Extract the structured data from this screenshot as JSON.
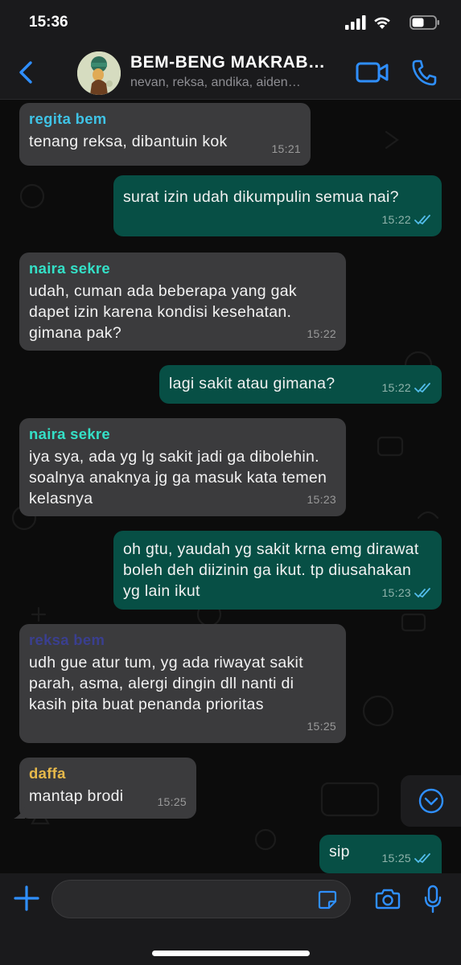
{
  "status_bar": {
    "time": "15:36",
    "icons": [
      "signal-icon",
      "wifi-icon",
      "battery-icon"
    ]
  },
  "header": {
    "title": "BEM-BENG MAKRAB…",
    "members": "nevan, reksa, andika, aiden…",
    "icons": [
      "back-icon",
      "video-call-icon",
      "phone-icon"
    ]
  },
  "colors": {
    "accent": "#2f8fff",
    "incoming_bubble": "#3b3b3d",
    "outgoing_bubble": "#074f45",
    "read_ticks": "#53bdeb"
  },
  "messages": [
    {
      "dir": "in",
      "sender": "regita bem",
      "sender_color": "#3fc3e6",
      "text": "tenang reksa, dibantuin kok",
      "time": "15:21"
    },
    {
      "dir": "out",
      "text": "surat izin udah dikumpulin semua nai?",
      "time": "15:22",
      "status": "read"
    },
    {
      "dir": "in",
      "sender": "naira sekre",
      "sender_color": "#34e0c7",
      "text": "udah, cuman ada beberapa yang gak dapet izin karena kondisi kesehatan. gimana pak?",
      "time": "15:22"
    },
    {
      "dir": "out",
      "text": "lagi sakit atau gimana?",
      "time": "15:22",
      "status": "read"
    },
    {
      "dir": "in",
      "sender": "naira sekre",
      "sender_color": "#34e0c7",
      "text": "iya sya, ada yg lg sakit jadi ga dibolehin. soalnya anaknya jg ga masuk kata temen kelasnya",
      "time": "15:23"
    },
    {
      "dir": "out",
      "text": "oh gtu, yaudah yg sakit krna emg dirawat boleh deh diizinin ga ikut. tp diusahakan yg lain ikut",
      "time": "15:23",
      "status": "read"
    },
    {
      "dir": "in",
      "sender": "reksa bem",
      "sender_color": "#3a3f8f",
      "text": "udh gue atur tum, yg ada riwayat sakit parah, asma, alergi dingin dll nanti di kasih pita buat penanda prioritas",
      "time": "15:25"
    },
    {
      "dir": "in",
      "sender": "daffa",
      "sender_color": "#e6b84a",
      "text": "mantap brodi",
      "time": "15:25"
    },
    {
      "dir": "out",
      "text": "sip",
      "time": "15:25",
      "status": "read"
    }
  ],
  "input": {
    "placeholder": "",
    "value": ""
  },
  "input_icons": [
    "plus-icon",
    "sticker-icon",
    "camera-icon",
    "mic-icon"
  ],
  "scroll_button_icon": "chevron-down-icon"
}
